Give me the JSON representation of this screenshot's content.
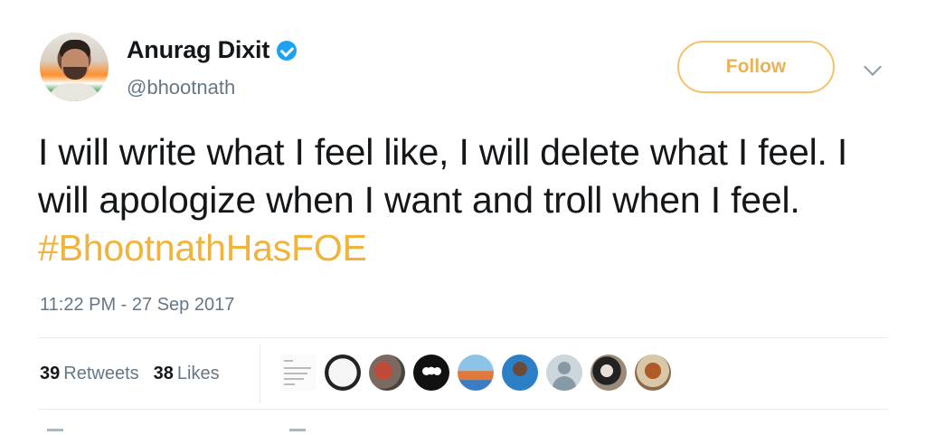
{
  "author": {
    "display_name": "Anurag Dixit",
    "handle": "@bhootnath",
    "verified": true
  },
  "follow_button": {
    "label": "Follow"
  },
  "menu": {
    "icon": "chevron-down-icon"
  },
  "tweet": {
    "text": "I will write what I feel like, I will delete what I feel. I will apologize when I want and troll when I feel.",
    "hashtag": "#BhootnathHasFOE",
    "timestamp": "11:22 PM - 27 Sep 2017"
  },
  "stats": {
    "retweets_count": "39",
    "retweets_label": "Retweets",
    "likes_count": "38",
    "likes_label": "Likes"
  },
  "likers": [
    "liker-avatar",
    "liker-avatar",
    "liker-avatar",
    "liker-avatar",
    "liker-avatar",
    "liker-avatar",
    "default-profile-avatar",
    "liker-avatar",
    "liker-avatar"
  ],
  "colors": {
    "accent": "#ebb254",
    "verified": "#1da1f2",
    "secondary_text": "#657786"
  }
}
